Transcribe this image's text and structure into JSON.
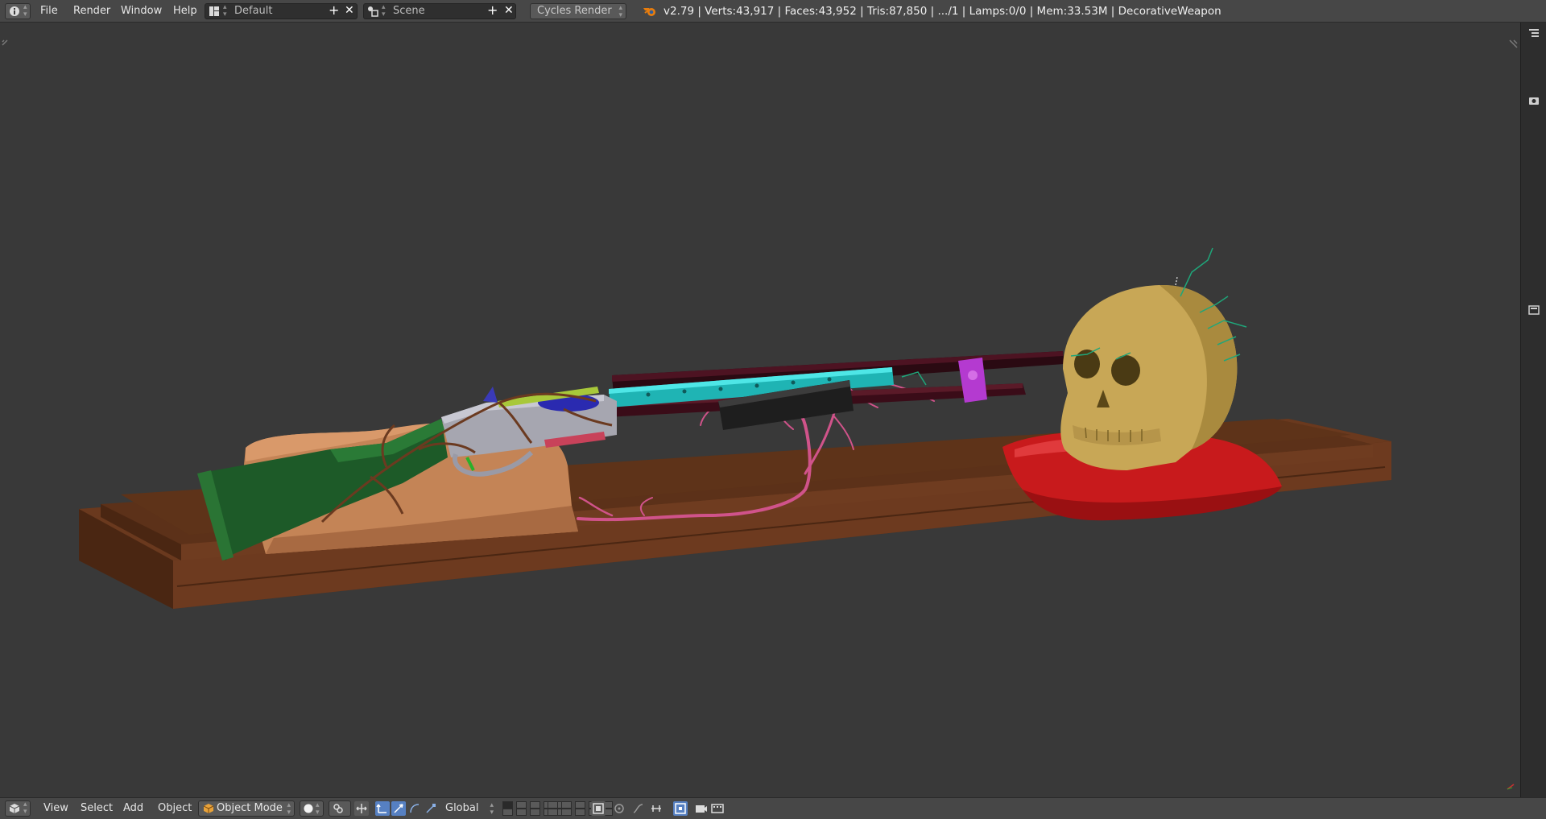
{
  "topbar": {
    "info_icon": "info-icon",
    "menus": [
      "File",
      "Render",
      "Window",
      "Help"
    ],
    "screen_layout": {
      "icon": "screen-layout-icon",
      "value": "Default"
    },
    "scene": {
      "icon": "scene-icon",
      "value": "Scene"
    },
    "render_engine": "Cycles Render",
    "blender_logo": "blender-logo-icon",
    "stats": "v2.79 | Verts:43,917 | Faces:43,952 | Tris:87,850 | .../1 | Lamps:0/0 | Mem:33.53M | DecorativeWeapon"
  },
  "viewport": {
    "objects": [
      "wooden-display-base",
      "shotgun",
      "skull",
      "red-cushion",
      "tan-rock-stand",
      "pink-vines",
      "wire-antennae"
    ],
    "colors": {
      "background": "#393939",
      "wood": "#6b3a20",
      "stock": "#1f5a2a",
      "barrel": "#2a0a12",
      "handguard": "#23c3c3",
      "receiver": "#a6a6b0",
      "skull": "#c8a756",
      "cushion": "#c81a1c",
      "rock": "#c78858",
      "vines": "#d0538a",
      "band": "#b43ad0"
    }
  },
  "bottombar": {
    "editor_icon": "3d-view-editor-icon",
    "menus": [
      "View",
      "Select",
      "Add",
      "Object"
    ],
    "mode": {
      "icon": "object-mode-icon",
      "value": "Object Mode"
    },
    "shading_icon": "solid-shading-icon",
    "pivot_icon": "pivot-point-icon",
    "manipulator_icons": [
      "manipulator-toggle-icon",
      "translate-manipulator-icon",
      "rotate-manipulator-icon",
      "scale-manipulator-icon"
    ],
    "orientation": "Global",
    "right_icons": [
      "layer-lock-icon",
      "proportional-edit-icon",
      "snap-icon",
      "snap-target-icon",
      "opengl-render-icon",
      "opengl-animation-icon"
    ]
  }
}
